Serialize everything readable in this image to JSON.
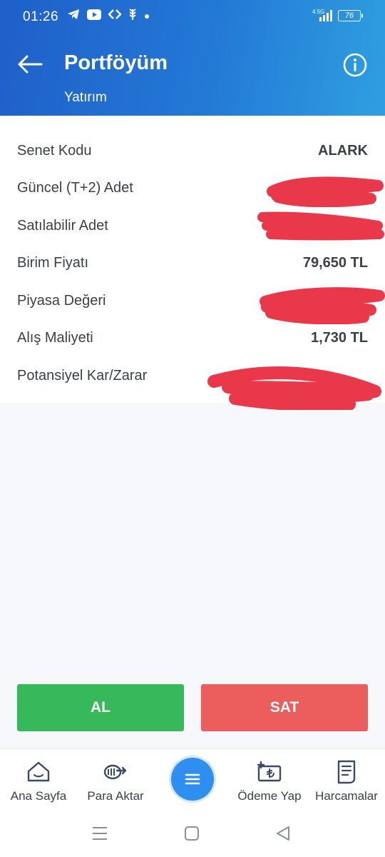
{
  "status_bar": {
    "time": "01:26",
    "network_label": "4.5G",
    "battery": "76",
    "icons": [
      "telegram-icon",
      "youtube-icon",
      "app-icon",
      "wheat-icon",
      "dot-icon"
    ]
  },
  "header": {
    "title": "Portföyüm",
    "subtitle": "Yatırım",
    "back_icon": "arrow-left-icon",
    "info_icon": "info-icon"
  },
  "details": [
    {
      "label": "Senet Kodu",
      "value": "ALARK",
      "redacted": false
    },
    {
      "label": "Güncel (T+2) Adet",
      "value": "",
      "redacted": true
    },
    {
      "label": "Satılabilir Adet",
      "value": "",
      "redacted": true
    },
    {
      "label": "Birim Fiyatı",
      "value": "79,650 TL",
      "redacted": false
    },
    {
      "label": "Piyasa Değeri",
      "value": "",
      "redacted": true
    },
    {
      "label": "Alış Maliyeti",
      "value": "1,730 TL",
      "redacted": false
    },
    {
      "label": "Potansiyel Kar/Zarar",
      "value": "",
      "redacted": true
    }
  ],
  "actions": {
    "buy_label": "AL",
    "sell_label": "SAT",
    "buy_color": "#37b95b",
    "sell_color": "#ec5e5e"
  },
  "bottom_nav": [
    {
      "label": "Ana Sayfa",
      "icon": "home-icon"
    },
    {
      "label": "Para Aktar",
      "icon": "transfer-icon"
    },
    {
      "label": "",
      "icon": "menu-icon"
    },
    {
      "label": "Ödeme Yap",
      "icon": "payment-icon"
    },
    {
      "label": "Harcamalar",
      "icon": "receipt-icon"
    }
  ],
  "colors": {
    "header_start": "#1f5fc9",
    "header_end": "#2f9fe0",
    "redaction": "#e8384a",
    "fab": "#2e8ff0"
  }
}
